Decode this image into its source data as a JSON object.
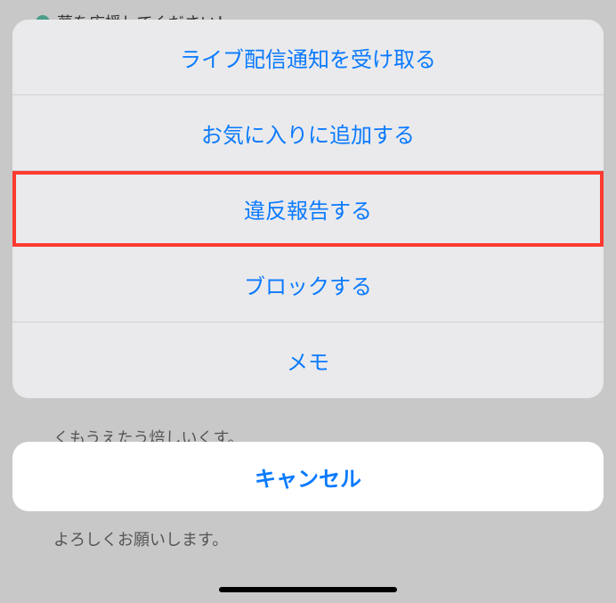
{
  "background": {
    "topMessage": "夢を応援してください！",
    "midText": "くもうえたう焙しいくす。",
    "bottomText": "よろしくお願いします。"
  },
  "actionSheet": {
    "items": [
      {
        "label": "ライブ配信通知を受け取る",
        "highlighted": false
      },
      {
        "label": "お気に入りに追加する",
        "highlighted": false
      },
      {
        "label": "違反報告する",
        "highlighted": true
      },
      {
        "label": "ブロックする",
        "highlighted": false
      },
      {
        "label": "メモ",
        "highlighted": false
      }
    ],
    "cancelLabel": "キャンセル"
  }
}
